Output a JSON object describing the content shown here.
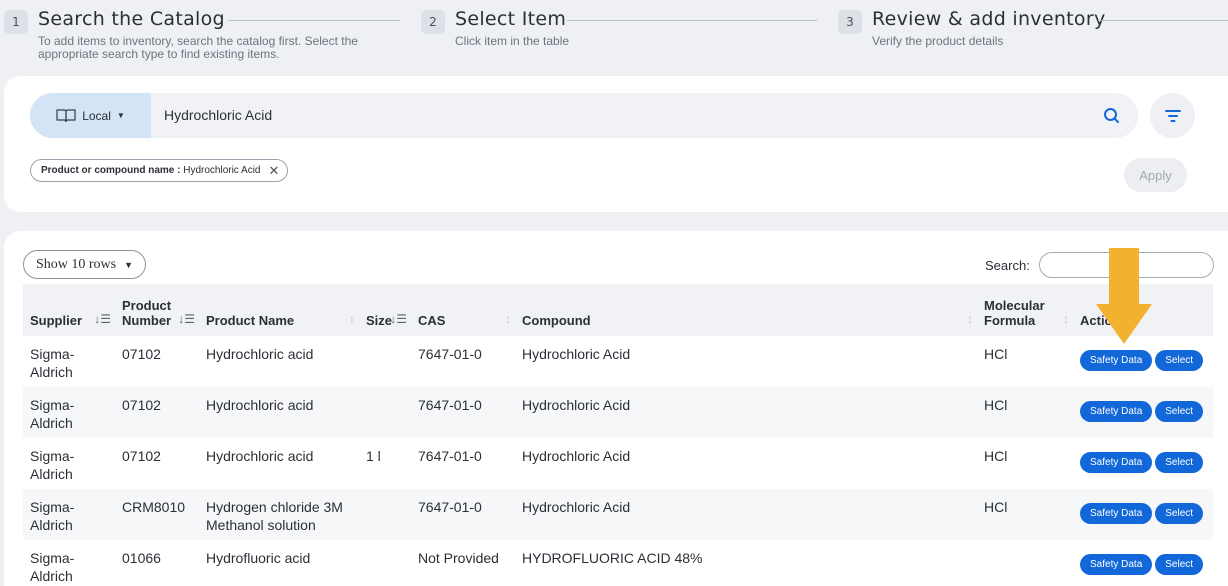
{
  "steps": [
    {
      "num": "1",
      "title": "Search the Catalog",
      "subtitle": "To add items to inventory, search the catalog first. Select the appropriate search type to find existing items."
    },
    {
      "num": "2",
      "title": "Select Item",
      "subtitle": "Click item in the table"
    },
    {
      "num": "3",
      "title": "Review & add inventory",
      "subtitle": "Verify the product details"
    }
  ],
  "search": {
    "source": "Local",
    "query": "Hydrochloric Acid",
    "chip_label": "Product or compound name :",
    "chip_value": "Hydrochloric Acid",
    "apply": "Apply"
  },
  "results": {
    "rows_select": "Show 10 rows",
    "search_label": "Search:",
    "search_value": "",
    "headers": {
      "supplier": "Supplier",
      "product_number": "Product Number",
      "product_name": "Product Name",
      "size": "Size",
      "cas": "CAS",
      "compound": "Compound",
      "formula": "Molecular Formula",
      "actions": "Actions"
    },
    "safety_label": "Safety Data",
    "select_label": "Select",
    "rows": [
      {
        "supplier": "Sigma-Aldrich",
        "number": "07102",
        "name": "Hydrochloric acid",
        "size": "",
        "cas": "7647-01-0",
        "compound": "Hydrochloric Acid",
        "formula": "HCl"
      },
      {
        "supplier": "Sigma-Aldrich",
        "number": "07102",
        "name": "Hydrochloric acid",
        "size": "",
        "cas": "7647-01-0",
        "compound": "Hydrochloric Acid",
        "formula": "HCl"
      },
      {
        "supplier": "Sigma-Aldrich",
        "number": "07102",
        "name": "Hydrochloric acid",
        "size": "1 l",
        "cas": "7647-01-0",
        "compound": "Hydrochloric Acid",
        "formula": "HCl"
      },
      {
        "supplier": "Sigma-Aldrich",
        "number": "CRM8010",
        "name": "Hydrogen chloride 3M Methanol solution",
        "size": "",
        "cas": "7647-01-0",
        "compound": "Hydrochloric Acid",
        "formula": "HCl"
      },
      {
        "supplier": "Sigma-Aldrich",
        "number": "01066",
        "name": "Hydrofluoric acid",
        "size": "",
        "cas": "Not Provided",
        "compound": "HYDROFLUORIC ACID 48%",
        "formula": ""
      }
    ]
  },
  "colors": {
    "accent": "#1268d8",
    "arrow": "#f2b230",
    "source_bg": "#d3e4f6"
  },
  "icons": [
    "book-icon",
    "search-icon",
    "filter-icon",
    "close-icon",
    "sort-icon",
    "chevron-down-icon",
    "arrow-down-icon"
  ]
}
